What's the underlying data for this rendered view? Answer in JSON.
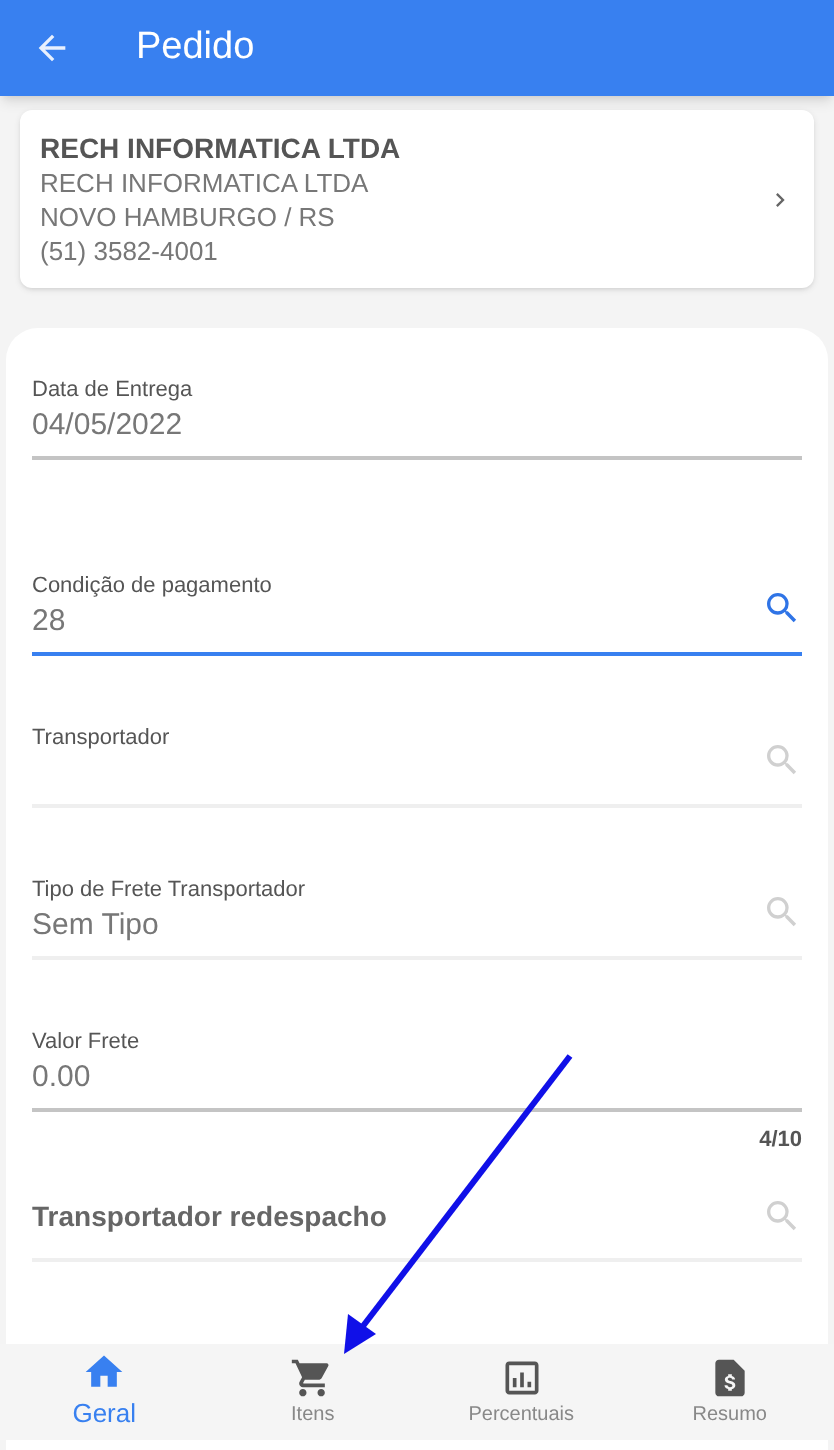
{
  "app_bar": {
    "title": "Pedido"
  },
  "customer": {
    "name": "RECH INFORMATICA LTDA",
    "lines": [
      "RECH INFORMATICA LTDA",
      "NOVO HAMBURGO / RS",
      "(51) 3582-4001"
    ]
  },
  "fields": [
    {
      "kind": "input",
      "label": "Data de Entrega",
      "value": "04/05/2022",
      "focused": false
    },
    {
      "kind": "lookup",
      "label": "Condição de pagamento",
      "value": "28",
      "focused": true
    },
    {
      "kind": "lookup",
      "label": "Transportador",
      "focused": false
    },
    {
      "kind": "lookup",
      "label": "Tipo de Frete Transportador",
      "value": "Sem Tipo",
      "focused": false
    },
    {
      "kind": "input",
      "label": "Valor Frete",
      "value": "0.00",
      "focused": false,
      "counter": "4/10"
    },
    {
      "kind": "lookup",
      "placeholder": "Transportador redespacho",
      "focused": false
    }
  ],
  "bottom_nav": [
    {
      "kind": "home",
      "label": "Geral",
      "selected": true
    },
    {
      "kind": "cart",
      "label": "Itens",
      "selected": false
    },
    {
      "kind": "chart",
      "label": "Percentuais",
      "selected": false
    },
    {
      "kind": "invoice",
      "label": "Resumo",
      "selected": false
    }
  ]
}
